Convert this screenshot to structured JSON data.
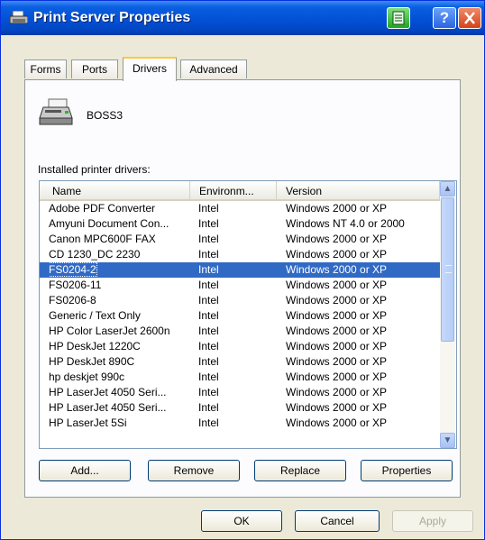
{
  "window": {
    "title": "Print Server Properties"
  },
  "tabs": [
    {
      "label": "Forms"
    },
    {
      "label": "Ports"
    },
    {
      "label": "Drivers"
    },
    {
      "label": "Advanced"
    }
  ],
  "server": {
    "name": "BOSS3"
  },
  "drivers": {
    "label": "Installed printer drivers:",
    "columns": [
      "Name",
      "Environm...",
      "Version"
    ],
    "rows": [
      {
        "name": "Adobe PDF Converter",
        "env": "Intel",
        "version": "Windows 2000 or XP"
      },
      {
        "name": "Amyuni Document Con...",
        "env": "Intel",
        "version": "Windows NT 4.0 or 2000"
      },
      {
        "name": "Canon MPC600F FAX",
        "env": "Intel",
        "version": "Windows 2000 or XP"
      },
      {
        "name": "CD 1230_DC 2230",
        "env": "Intel",
        "version": "Windows 2000 or XP"
      },
      {
        "name": "FS0204-2",
        "env": "Intel",
        "version": "Windows 2000 or XP"
      },
      {
        "name": "FS0206-11",
        "env": "Intel",
        "version": "Windows 2000 or XP"
      },
      {
        "name": "FS0206-8",
        "env": "Intel",
        "version": "Windows 2000 or XP"
      },
      {
        "name": "Generic / Text Only",
        "env": "Intel",
        "version": "Windows 2000 or XP"
      },
      {
        "name": "HP Color LaserJet 2600n",
        "env": "Intel",
        "version": "Windows 2000 or XP"
      },
      {
        "name": "HP DeskJet 1220C",
        "env": "Intel",
        "version": "Windows 2000 or XP"
      },
      {
        "name": "HP DeskJet 890C",
        "env": "Intel",
        "version": "Windows 2000 or XP"
      },
      {
        "name": "hp deskjet 990c",
        "env": "Intel",
        "version": "Windows 2000 or XP"
      },
      {
        "name": "HP LaserJet 4050 Seri...",
        "env": "Intel",
        "version": "Windows 2000 or XP"
      },
      {
        "name": "HP LaserJet 4050 Seri...",
        "env": "Intel",
        "version": "Windows 2000 or XP"
      },
      {
        "name": "HP LaserJet 5Si",
        "env": "Intel",
        "version": "Windows 2000 or XP"
      }
    ]
  },
  "buttons": {
    "add": "Add...",
    "remove": "Remove",
    "replace": "Replace",
    "properties": "Properties",
    "ok": "OK",
    "cancel": "Cancel",
    "apply": "Apply"
  },
  "icons": {
    "app": "printer-server-icon",
    "server": "printer-icon",
    "green": "green-notebook-icon",
    "help": "help-icon",
    "close": "close-icon"
  },
  "colors": {
    "titlebar": "#0350d6",
    "selection": "#316ac5",
    "face": "#ece9d8"
  }
}
